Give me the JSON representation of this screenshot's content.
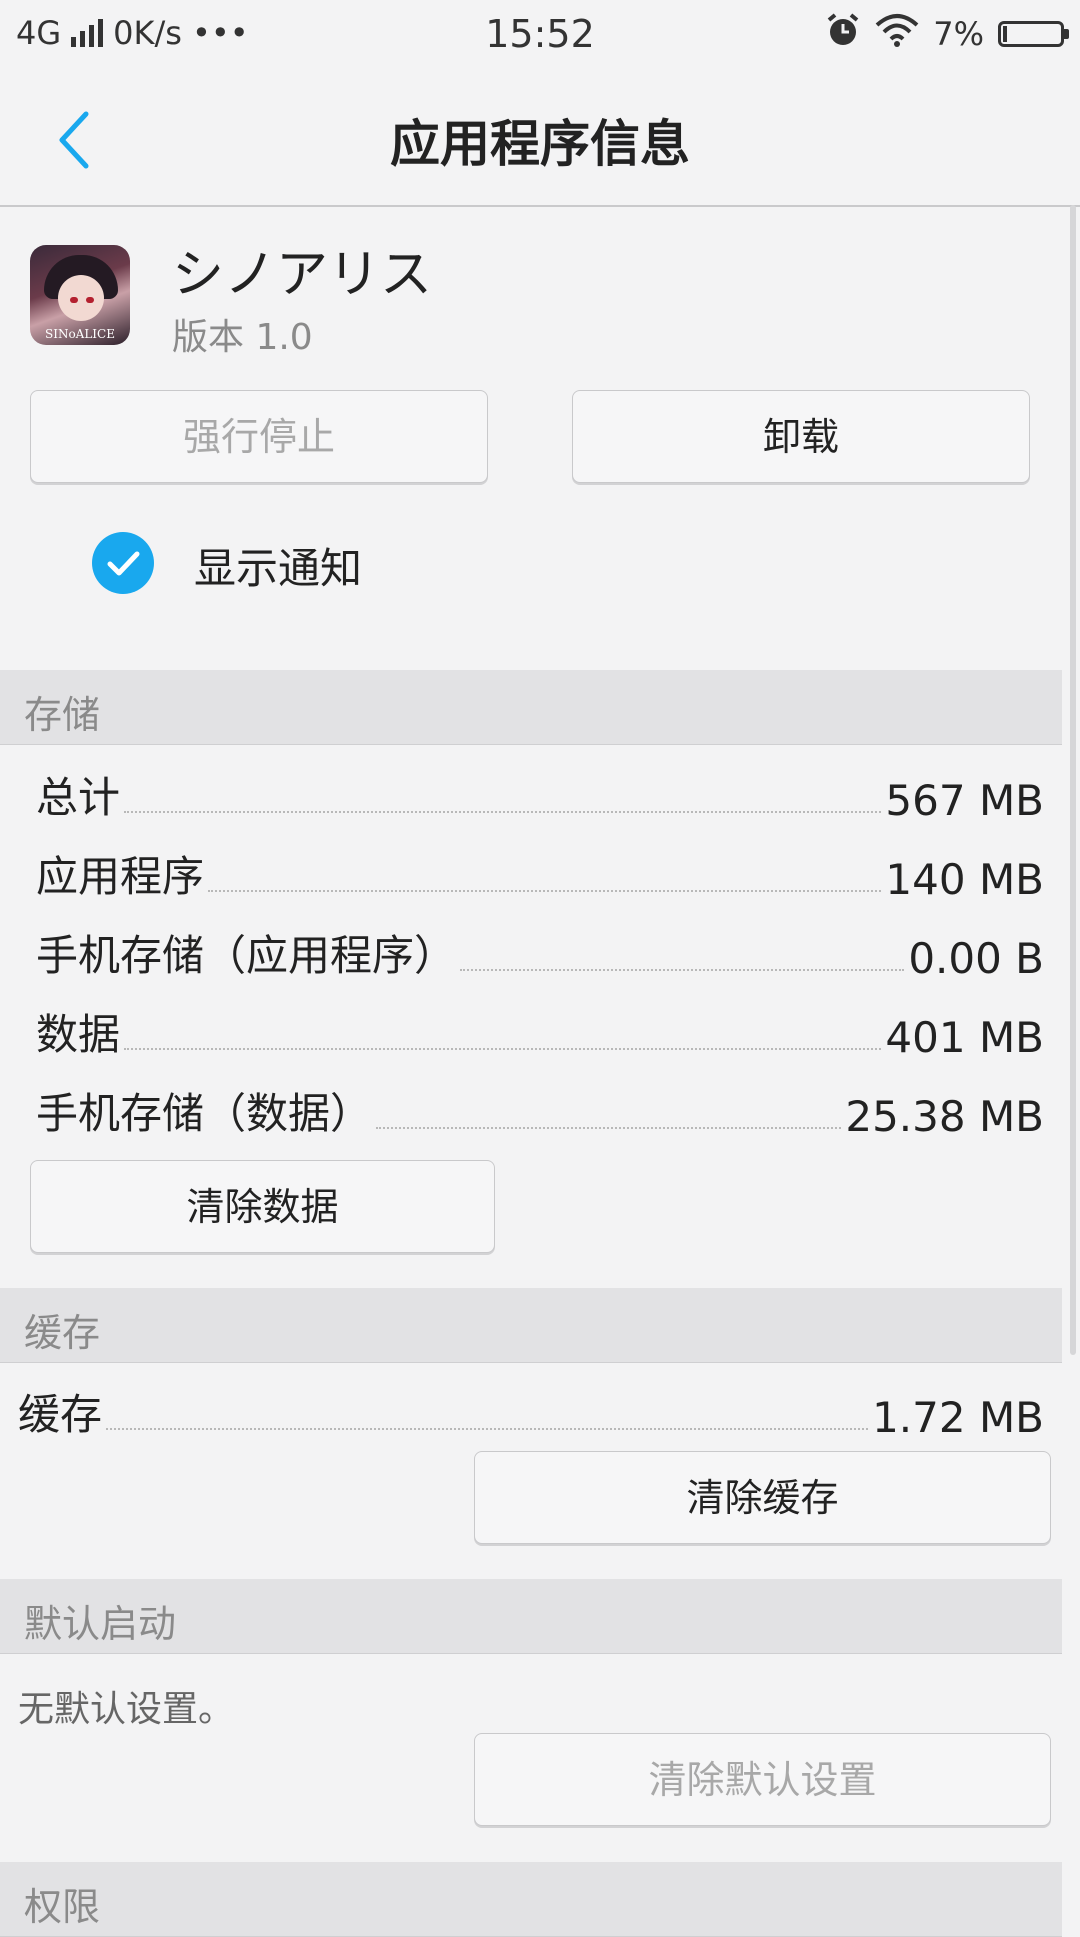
{
  "status_bar": {
    "network": "4G",
    "speed": "0K/s",
    "more": "•••",
    "time": "15:52",
    "battery_text": "7%",
    "battery_level": 0.07,
    "icons": [
      "signal-icon",
      "alarm-icon",
      "wifi-icon",
      "battery-icon"
    ]
  },
  "header": {
    "title": "应用程序信息",
    "back_icon": "chevron-left-icon"
  },
  "app": {
    "name": "シノアリス",
    "version": "版本 1.0",
    "icon_text": "SINoALICE"
  },
  "actions": {
    "force_stop": "强行停止",
    "uninstall": "卸载"
  },
  "notification": {
    "label": "显示通知",
    "checked": true
  },
  "storage": {
    "header": "存储",
    "rows": [
      {
        "label": "总计",
        "value": "567 MB"
      },
      {
        "label": "应用程序",
        "value": "140 MB"
      },
      {
        "label": "手机存储（应用程序）",
        "value": "0.00 B"
      },
      {
        "label": "数据",
        "value": "401 MB"
      },
      {
        "label": "手机存储（数据）",
        "value": "25.38 MB"
      }
    ],
    "clear_button": "清除数据"
  },
  "cache": {
    "header": "缓存",
    "label": "缓存",
    "value": "1.72 MB",
    "clear_button": "清除缓存"
  },
  "default_launch": {
    "header": "默认启动",
    "text": "无默认设置。",
    "clear_button": "清除默认设置"
  },
  "permissions": {
    "header": "权限"
  },
  "colors": {
    "accent": "#19a8ee",
    "background": "#f3f3f4",
    "section_header_bg": "#e2e2e4"
  }
}
